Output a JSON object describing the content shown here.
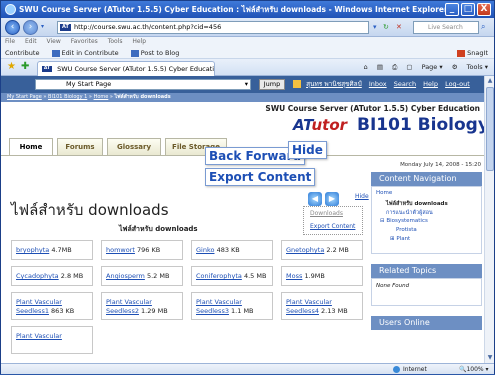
{
  "window": {
    "title": "SWU Course Server (ATutor 1.5.5) Cyber Education : ไฟล์สำหรับ downloads - Windows Internet Explorer",
    "buttons": {
      "minimize": "_",
      "maximize": "□",
      "close": "X"
    }
  },
  "browser": {
    "address": "http://course.swu.ac.th/content.php?cid=456",
    "search_placeholder": "Live Search",
    "menu": [
      "File",
      "Edit",
      "View",
      "Favorites",
      "Tools",
      "Help"
    ],
    "links": [
      "Contribute",
      "Edit in Contribute",
      "Post to Blog"
    ],
    "links_right": [
      "SnagIt"
    ],
    "tab_label": "SWU Course Server (ATutor 1.5.5) Cyber Education :...",
    "tab_tools": [
      "Page",
      "Tools"
    ]
  },
  "atutor": {
    "jump_value": "My Start Page",
    "jump_button": "Jump",
    "user_links": [
      "สุนทร พานิชสุขศิลป์",
      "Inbox",
      "Search",
      "Help",
      "Log-out"
    ],
    "breadcrumb": [
      "My Start Page",
      "BI101 Biology 1",
      "Home",
      "ไฟล์สำหรับ downloads"
    ],
    "server_name": "SWU Course Server (ATutor 1.5.5) Cyber Education",
    "logo_a": "AT",
    "logo_rest": "utor",
    "course_title": "BI101 Biology 1",
    "tabs": [
      "Home",
      "Forums",
      "Glossary",
      "File Storage"
    ],
    "date": "Monday July 14, 2008 - 15:20",
    "callouts": {
      "back_forward": "Back Forward",
      "hide": "Hide",
      "export": "Export Content"
    },
    "hide_link": "Hide",
    "toolbox": {
      "downloads": "Downloads",
      "export": "Export Content"
    },
    "page_heading": "ไฟล์สำหรับ downloads",
    "sub_heading": "ไฟล์สำหรับ downloads",
    "files": [
      {
        "name": "bryophyta",
        "size": "4.7MB"
      },
      {
        "name": "homwort",
        "size": "796 KB"
      },
      {
        "name": "Ginko",
        "size": "483 KB"
      },
      {
        "name": "Gnetophyta",
        "size": "2.2 MB"
      },
      {
        "name": "Cycadophyta",
        "size": "2.8 MB"
      },
      {
        "name": "Angiosperm",
        "size": "5.2 MB"
      },
      {
        "name": "Coniferophyta",
        "size": "4.5 MB"
      },
      {
        "name": "Moss",
        "size": "1.9MB"
      },
      {
        "name": "Plant Vascular Seedless1",
        "size": "863 KB"
      },
      {
        "name": "Plant Vascular Seedless2",
        "size": "1.29 MB"
      },
      {
        "name": "Plant Vascular Seedless3",
        "size": "1.1 MB"
      },
      {
        "name": "Plant Vascular Seedless4",
        "size": "2.13 MB"
      },
      {
        "name": "Plant Vascular",
        "size": ""
      }
    ],
    "side": {
      "content_nav_title": "Content Navigation",
      "nav_items": [
        "Home",
        "ไฟล์สำหรับ downloads",
        "การแนะนำตัวผู้สอน",
        "Biosystematics",
        "Protista",
        "Plant"
      ],
      "related_title": "Related Topics",
      "related_text": "None Found",
      "users_online_title": "Users Online"
    }
  },
  "status": {
    "zone": "Internet",
    "zoom": "100%"
  }
}
